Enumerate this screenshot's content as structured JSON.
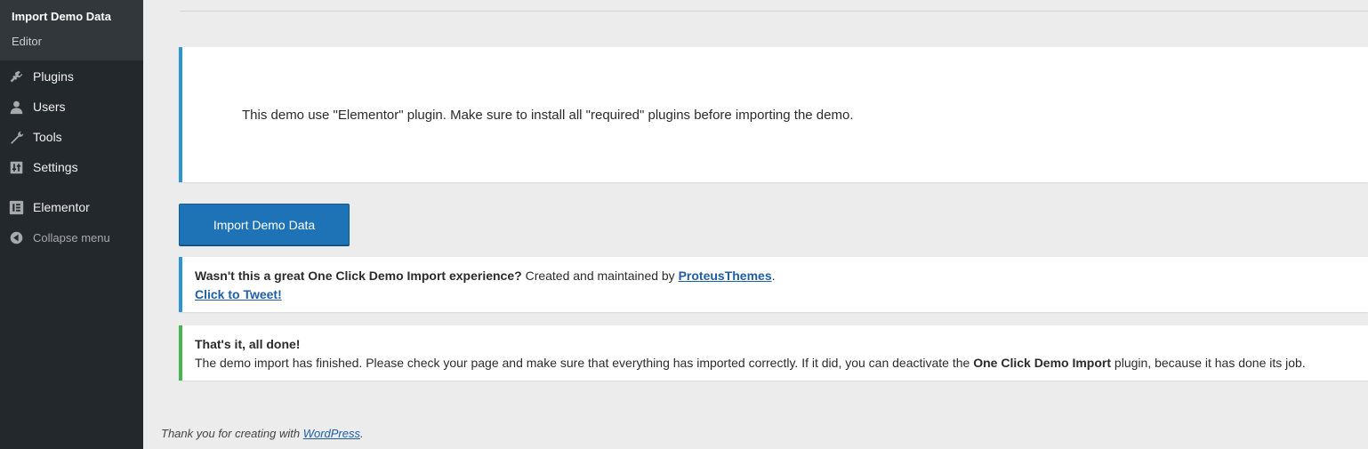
{
  "sidebar": {
    "submenu": {
      "active_label": "Import Demo Data",
      "editor_label": "Editor"
    },
    "items": [
      {
        "label": "Plugins",
        "icon": "plugins-icon"
      },
      {
        "label": "Users",
        "icon": "users-icon"
      },
      {
        "label": "Tools",
        "icon": "tools-icon"
      },
      {
        "label": "Settings",
        "icon": "settings-icon"
      },
      {
        "label": "Elementor",
        "icon": "elementor-icon"
      },
      {
        "label": "Collapse menu",
        "icon": "collapse-icon"
      }
    ]
  },
  "intro_notice": {
    "text": "This demo use \"Elementor\" plugin. Make sure to install all \"required\" plugins before importing the demo."
  },
  "import_button_label": "Import Demo Data",
  "rate_notice": {
    "question": "Wasn't this a great One Click Demo Import experience?",
    "created_by": " Created and maintained by ",
    "author_link": "ProteusThemes",
    "period": ".",
    "tweet_link": "Click to Tweet!"
  },
  "done_notice": {
    "title": "That's it, all done!",
    "body_start": "The demo import has finished. Please check your page and make sure that everything has imported correctly. If it did, you can deactivate the ",
    "plugin_name": "One Click Demo Import",
    "body_end": " plugin, because it has done its job."
  },
  "footer": {
    "text": "Thank you for creating with ",
    "link": "WordPress",
    "period": "."
  },
  "colors": {
    "sidebar_bg": "#23282d",
    "submenu_bg": "#32373c",
    "info_accent": "#2e95d3",
    "success_accent": "#46b450",
    "button_bg": "#1e72b6",
    "link": "#1e5ea8"
  }
}
